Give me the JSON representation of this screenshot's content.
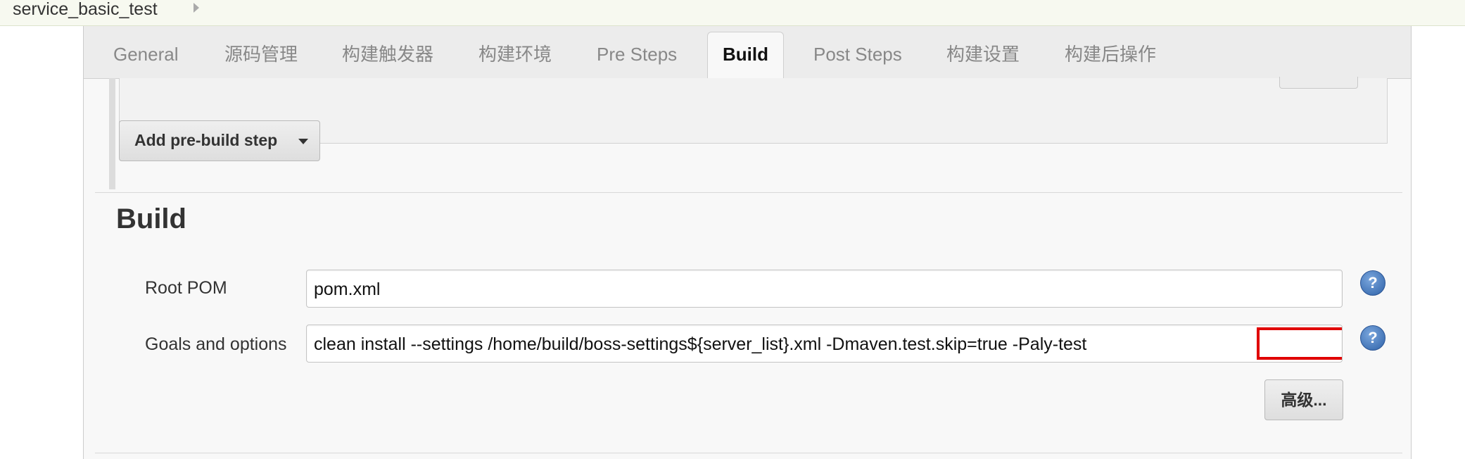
{
  "breadcrumb": {
    "label": "service_basic_test"
  },
  "tabs": [
    {
      "label": "General"
    },
    {
      "label": "源码管理"
    },
    {
      "label": "构建触发器"
    },
    {
      "label": "构建环境"
    },
    {
      "label": "Pre Steps"
    },
    {
      "label": "Build"
    },
    {
      "label": "Post Steps"
    },
    {
      "label": "构建设置"
    },
    {
      "label": "构建后操作"
    }
  ],
  "active_tab": "Build",
  "prebuild": {
    "add_button_label": "Add pre-build step"
  },
  "build": {
    "title": "Build",
    "root_pom": {
      "label": "Root POM",
      "value": "pom.xml"
    },
    "goals": {
      "label": "Goals and options",
      "value_main": "clean install --settings /home/build/boss-settings${server_list}.xml -Dmaven.test.skip=true ",
      "value_highlighted": "-Paly-test"
    },
    "help_icon_glyph": "?",
    "advanced_button_label": "高级..."
  },
  "colors": {
    "highlight": "#e00000",
    "help_icon": "#2e62a8"
  }
}
